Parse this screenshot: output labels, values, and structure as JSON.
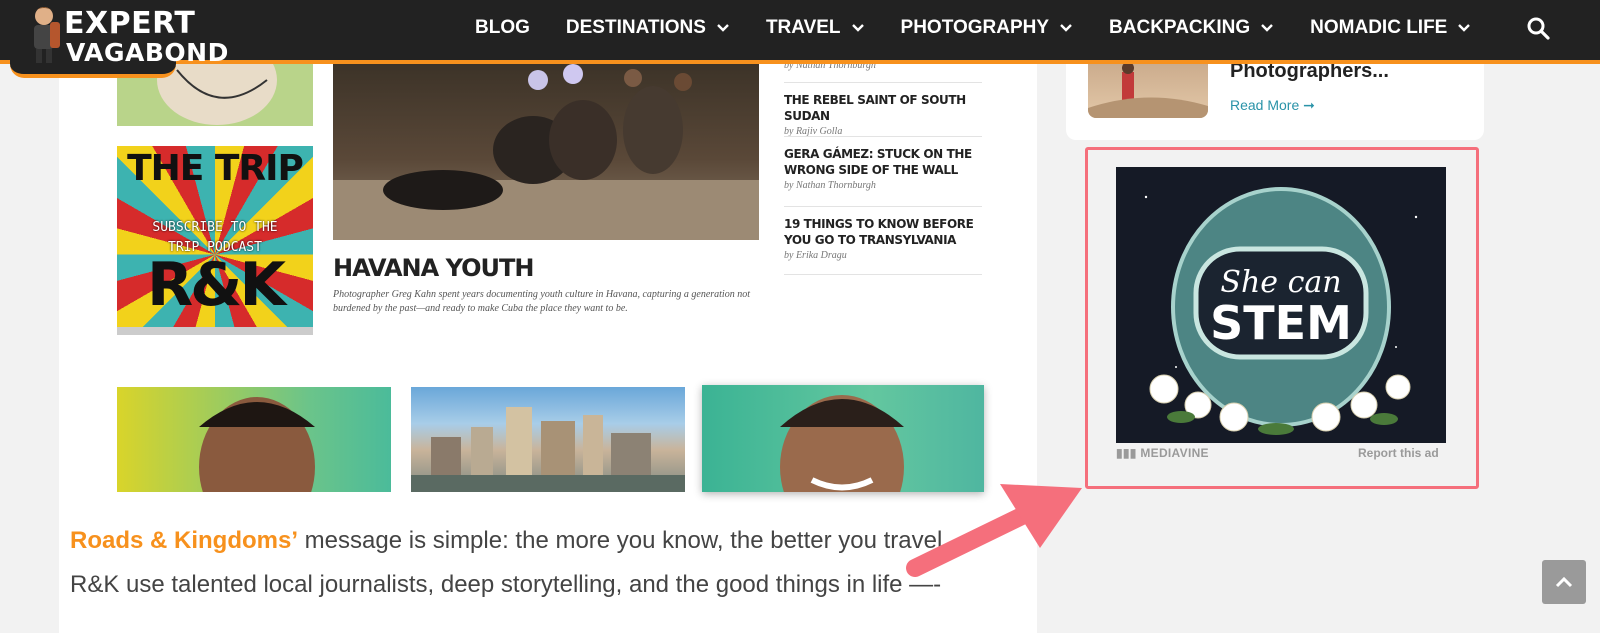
{
  "logo": {
    "line1": "EXPERT",
    "line2": "VAGABOND"
  },
  "nav": {
    "items": [
      {
        "label": "BLOG",
        "dropdown": false
      },
      {
        "label": "DESTINATIONS",
        "dropdown": true
      },
      {
        "label": "TRAVEL",
        "dropdown": true
      },
      {
        "label": "PHOTOGRAPHY",
        "dropdown": true
      },
      {
        "label": "BACKPACKING",
        "dropdown": true
      },
      {
        "label": "NOMADIC LIFE",
        "dropdown": true
      }
    ],
    "search_icon": "search-icon"
  },
  "article_screenshot": {
    "trip_card": {
      "title": "THE TRIP",
      "subtitle": "SUBSCRIBE TO THE TRIP PODCAST",
      "brand": "R&K"
    },
    "feature": {
      "title": "HAVANA YOUTH",
      "caption": "Photographer Greg Kahn spent years documenting youth culture in Havana, capturing a generation not burdened by the past—and ready to make Cuba the place they want to be."
    },
    "top_byline": "by Nathan Thornburgh",
    "side_list": [
      {
        "title": "THE REBEL SAINT OF SOUTH SUDAN",
        "byline": "by Rajiv Golla"
      },
      {
        "title": "GERA GÁMEZ: STUCK ON THE WRONG SIDE OF THE WALL",
        "byline": "by Nathan Thornburgh"
      },
      {
        "title": "19 THINGS TO KNOW BEFORE YOU GO TO TRANSYLVANIA",
        "byline": "by Erika Dragu"
      }
    ]
  },
  "body": {
    "p1_link": "Roads & Kingdoms’",
    "p1_text": " message is simple: the more you know, the better you travel.",
    "p2_text": "R&K use talented local journalists, deep storytelling, and the good things in life —-"
  },
  "sidebar": {
    "card": {
      "title": "Photographers...",
      "read_more": "Read More ➞"
    },
    "ad": {
      "image_text_1": "She can",
      "image_text_2": "STEM",
      "brand": "MEDIAVINE",
      "report": "Report this ad"
    }
  },
  "colors": {
    "accent": "#f7911d",
    "header_bg": "#222222",
    "highlight": "#f56f7c",
    "link": "#2a93a8"
  },
  "back_to_top_icon": "chevron-up-icon"
}
